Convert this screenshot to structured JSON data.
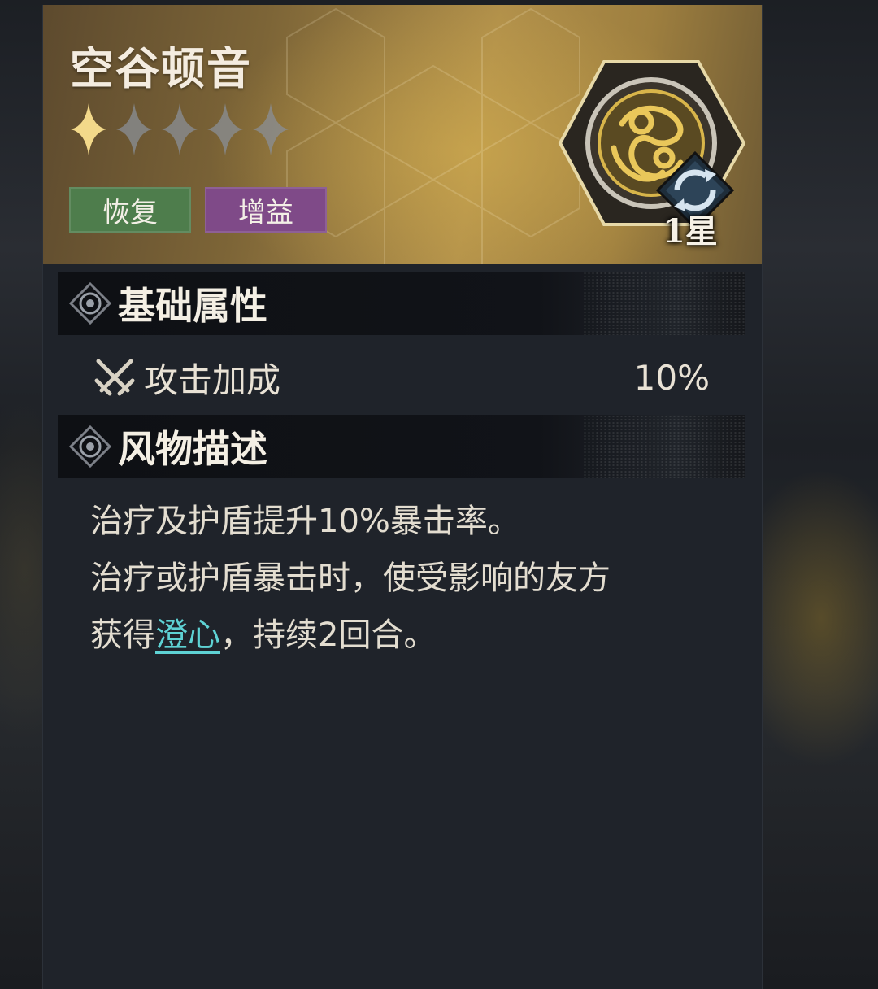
{
  "item": {
    "name": "空谷顿音",
    "rarity": {
      "filled": 1,
      "total": 5
    },
    "star_level_label": "1星",
    "tags": [
      {
        "label": "恢复",
        "color": "#4e7d4c"
      },
      {
        "label": "增益",
        "color": "#7f4a88"
      }
    ]
  },
  "sections": {
    "base_attributes": {
      "title": "基础属性"
    },
    "description": {
      "title": "风物描述"
    }
  },
  "stats": [
    {
      "name": "攻击加成",
      "value": "10%",
      "icon": "crossed-swords-icon"
    }
  ],
  "description": {
    "line1": "治疗及护盾提升10%暴击率。",
    "line2": "治疗或护盾暴击时，使受影响的友方",
    "line3_prefix": "获得",
    "line3_keyword": "澄心",
    "line3_suffix": "，持续2回合。"
  },
  "colors": {
    "header_gold": "#b08f4a",
    "keyword_cyan": "#5ed2d4",
    "star_filled": "#f3d98a",
    "star_empty": "#8a8f97"
  }
}
